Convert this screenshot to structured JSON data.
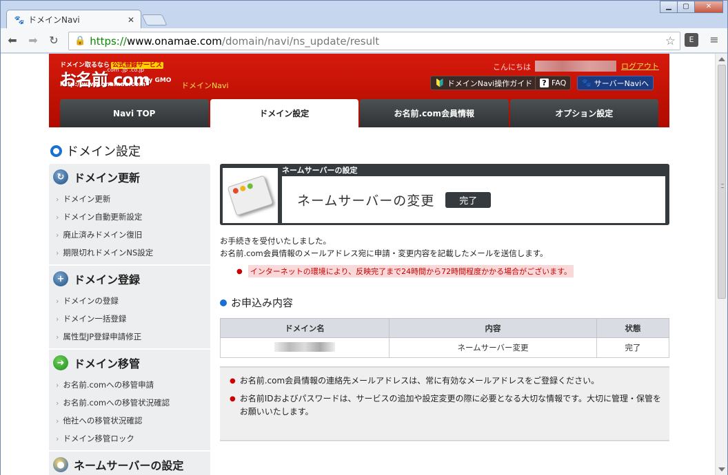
{
  "browser": {
    "tab_title": "ドメインNavi",
    "url_scheme": "https://",
    "url_host": "www.onamae.com",
    "url_path": "/domain/navi/ns_update/result"
  },
  "header": {
    "logo_tagline": "ドメイン取るなら",
    "logo_badge": "公式登録サービス",
    "logo_tlds": ".com .jp .co.jp",
    "logo_name": "お名前.com",
    "logo_url": "http://www.onamae.com",
    "logo_gmo": "by GMO",
    "subtitle": "ドメインNavi",
    "greeting": "こんにちは",
    "logout": "ログアウト",
    "guide_button": "ドメインNavi操作ガイド",
    "faq_button": "FAQ",
    "server_button": "サーバーNaviへ"
  },
  "tabs": [
    "Navi TOP",
    "ドメイン設定",
    "お名前.com会員情報",
    "オプション設定"
  ],
  "page_title": "ドメイン設定",
  "sidebar": {
    "groups": [
      {
        "title": "ドメイン更新",
        "items": [
          "ドメイン更新",
          "ドメイン自動更新設定",
          "廃止済みドメイン復旧",
          "期限切れドメインNS設定"
        ]
      },
      {
        "title": "ドメイン登録",
        "items": [
          "ドメインの登録",
          "ドメイン一括登録",
          "属性型JP登録申請修正"
        ]
      },
      {
        "title": "ドメイン移管",
        "items": [
          "お名前.comへの移管申請",
          "お名前.comへの移管状況確認",
          "他社への移管状況確認",
          "ドメイン移管ロック"
        ]
      },
      {
        "title": "ネームサーバーの設定",
        "items": []
      }
    ]
  },
  "main": {
    "step_header": "ネームサーバーの設定",
    "step_title": "ネームサーバーの変更",
    "step_badge": "完了",
    "message_1": "お手続きを受付いたしました。",
    "message_2": "お名前.com会員情報のメールアドレス宛に申請・変更内容を記載したメールを送信します。",
    "warning": "インターネットの環境により、反映完了まで24時間から72時間程度かかる場合がございます。",
    "section_title": "お申込み内容",
    "table": {
      "headers": [
        "ドメイン名",
        "内容",
        "状態"
      ],
      "rows": [
        {
          "content": "ネームサーバー変更",
          "status": "完了"
        }
      ]
    },
    "notes": [
      "お名前.com会員情報の連絡先メールアドレスは、常に有効なメールアドレスをご登録ください。",
      "お名前IDおよびパスワードは、サービスの追加や設定変更の際に必要となる大切な情報です。大切に管理・保管をお願いいたします。"
    ]
  },
  "colors": {
    "brand_red": "#d61a0c",
    "accent_blue": "#1a6fd0",
    "dark_nav": "#353a3e"
  }
}
